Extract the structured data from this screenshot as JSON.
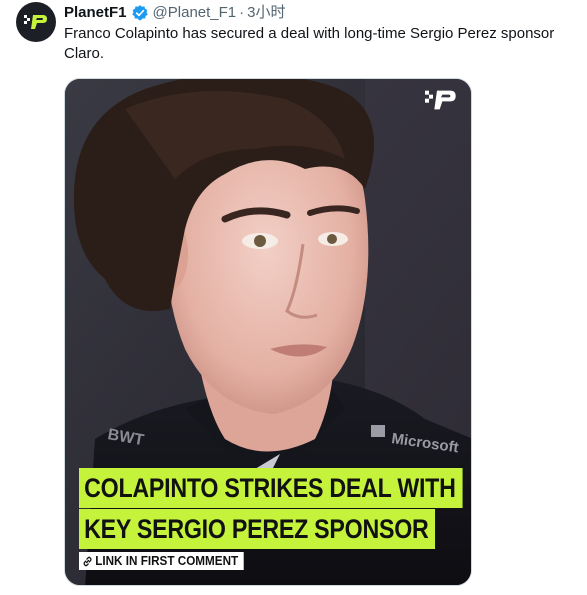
{
  "tweet": {
    "author_name": "PlanetF1",
    "handle": "@Planet_F1",
    "separator": "·",
    "time": "3小时",
    "text": "Franco Colapinto has secured a deal with long-time Sergio Perez sponsor Claro."
  },
  "media": {
    "headline_line1": "COLAPINTO STRIKES DEAL WITH",
    "headline_line2": "KEY SERGIO PEREZ SPONSOR",
    "link_label": "LINK IN FIRST COMMENT",
    "logo_text": "Microsoft",
    "jersey_text": "BWT",
    "accent_color": "#c5f33b"
  },
  "icons": {
    "avatar": "planetf1-logo-icon",
    "verified": "verified-badge-icon",
    "link": "link-icon"
  }
}
